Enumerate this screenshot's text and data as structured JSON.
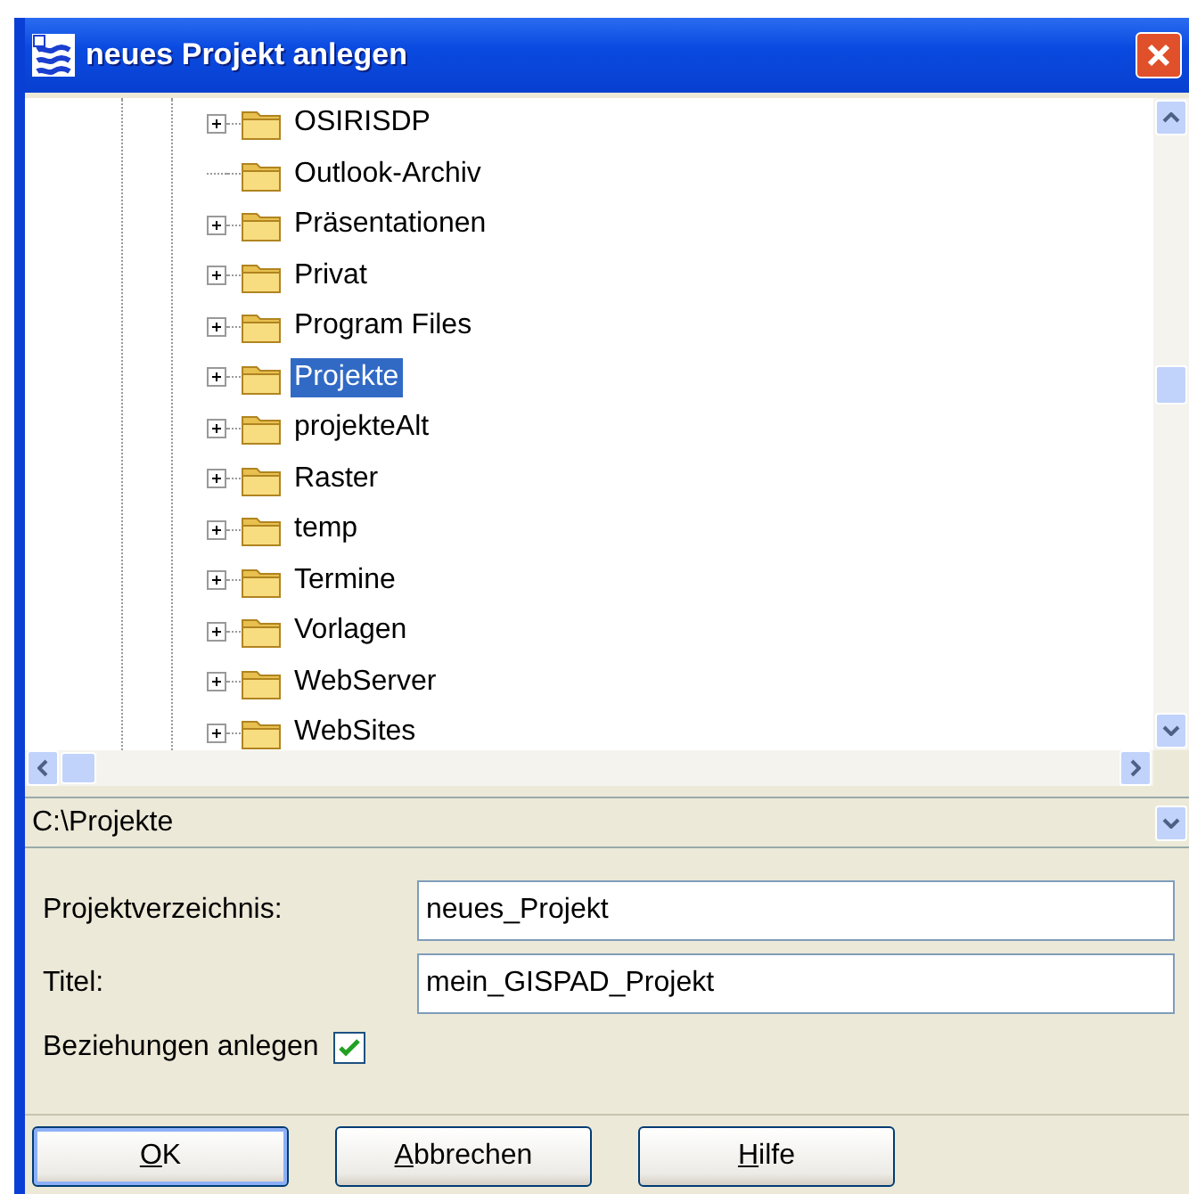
{
  "window": {
    "title": "neues Projekt anlegen"
  },
  "tree": {
    "items": [
      {
        "label": "OSIRISDP",
        "expandable": true,
        "selected": false
      },
      {
        "label": "Outlook-Archiv",
        "expandable": false,
        "selected": false
      },
      {
        "label": "Präsentationen",
        "expandable": true,
        "selected": false
      },
      {
        "label": "Privat",
        "expandable": true,
        "selected": false
      },
      {
        "label": "Program Files",
        "expandable": true,
        "selected": false
      },
      {
        "label": "Projekte",
        "expandable": true,
        "selected": true
      },
      {
        "label": "projekteAlt",
        "expandable": true,
        "selected": false
      },
      {
        "label": "Raster",
        "expandable": true,
        "selected": false
      },
      {
        "label": "temp",
        "expandable": true,
        "selected": false
      },
      {
        "label": "Termine",
        "expandable": true,
        "selected": false
      },
      {
        "label": "Vorlagen",
        "expandable": true,
        "selected": false
      },
      {
        "label": "WebServer",
        "expandable": true,
        "selected": false
      },
      {
        "label": "WebSites",
        "expandable": true,
        "selected": false
      }
    ]
  },
  "path_combo": {
    "value": "C:\\Projekte"
  },
  "form": {
    "fields": [
      {
        "label": "Projektverzeichnis:",
        "value": "neues_Projekt"
      },
      {
        "label": "Titel:",
        "value": "mein_GISPAD_Projekt"
      }
    ],
    "checkbox": {
      "label": "Beziehungen anlegen",
      "checked": true
    }
  },
  "buttons": [
    {
      "access_key": "O",
      "label_rest": "K",
      "default": true
    },
    {
      "access_key": "A",
      "label_rest": "bbrechen",
      "default": false
    },
    {
      "access_key": "H",
      "label_rest": "ilfe",
      "default": false
    }
  ]
}
